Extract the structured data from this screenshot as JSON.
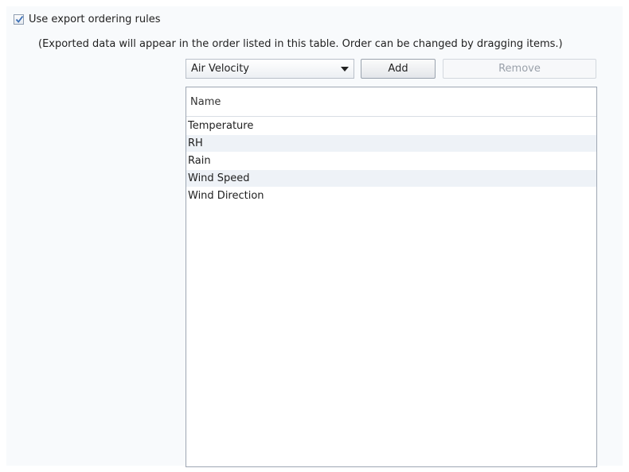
{
  "export_rules": {
    "checkbox_label": "Use export ordering rules",
    "checked": true,
    "hint": "(Exported data will appear in the order listed in this table. Order can be changed by dragging items.)"
  },
  "controls": {
    "dropdown_value": "Air Velocity",
    "add_label": "Add",
    "remove_label": "Remove",
    "remove_enabled": false
  },
  "table": {
    "column_header": "Name",
    "rows": [
      "Temperature",
      "RH",
      "Rain",
      "Wind Speed",
      "Wind Direction"
    ]
  },
  "icons": {
    "checkbox": "checkmark-icon",
    "dropdown": "triangle-down-icon"
  }
}
